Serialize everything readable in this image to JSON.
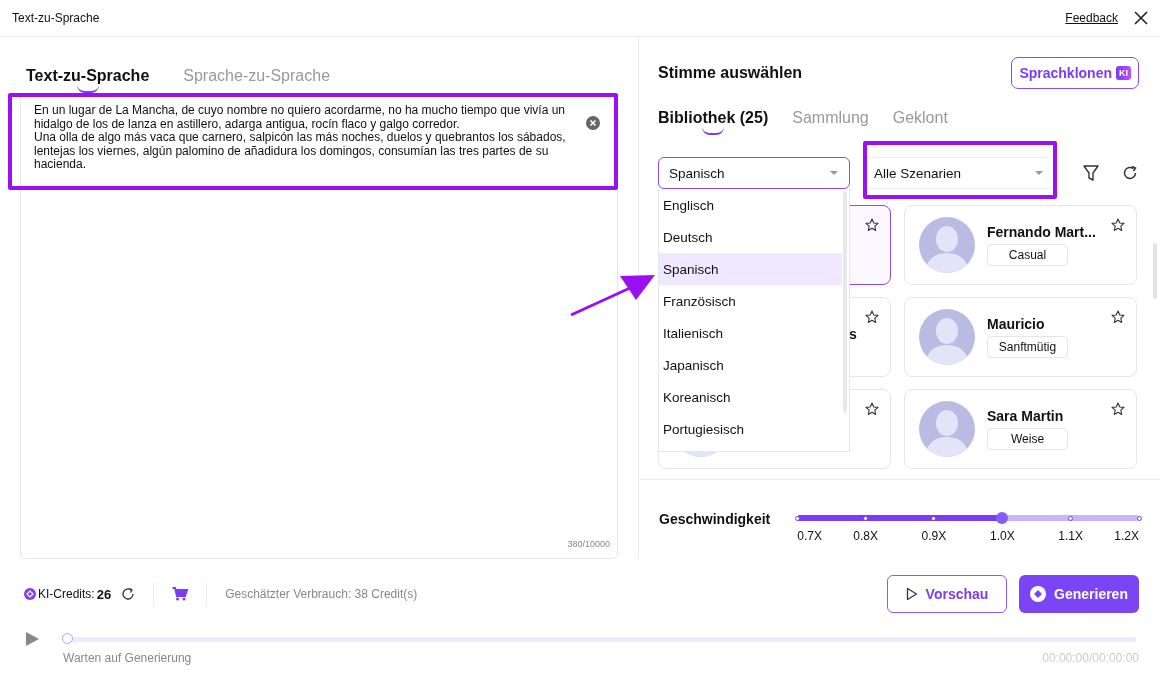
{
  "window": {
    "title": "Text-zu-Sprache",
    "feedback": "Feedback"
  },
  "mode_tabs": [
    {
      "label": "Text-zu-Sprache",
      "selected": true
    },
    {
      "label": "Sprache-zu-Sprache",
      "selected": false
    }
  ],
  "editor": {
    "paragraphs": [
      "En un lugar de La Mancha, de cuyo nombre no quiero acordarme, no ha mucho tiempo que vivía un hidalgo de los de lanza en astillero, adarga antigua, rocín flaco y galgo corredor.",
      "Una olla de algo más vaca que carnero, salpicón las más noches, duelos y quebrantos los sábados, lentejas los viernes, algún palomino de añadidura los domingos, consumían las tres partes de su hacienda."
    ],
    "char_count": "380/10000"
  },
  "voice_panel": {
    "title": "Stimme auswählen",
    "clone_button": "Sprachklonen",
    "clone_badge": "KI",
    "tabs": [
      {
        "label": "Bibliothek (25)",
        "selected": true
      },
      {
        "label": "Sammlung",
        "selected": false
      },
      {
        "label": "Geklont",
        "selected": false
      }
    ],
    "language_select": "Spanisch",
    "scenario_select": "Alle Szenarien",
    "language_options": [
      {
        "label": "Englisch",
        "selected": false
      },
      {
        "label": "Deutsch",
        "selected": false
      },
      {
        "label": "Spanisch",
        "selected": true
      },
      {
        "label": "Französisch",
        "selected": false
      },
      {
        "label": "Italienisch",
        "selected": false
      },
      {
        "label": "Japanisch",
        "selected": false
      },
      {
        "label": "Koreanisch",
        "selected": false
      },
      {
        "label": "Portugiesisch",
        "selected": false
      }
    ],
    "voices": [
      {
        "selected": true
      },
      {
        "avatar": true,
        "name": "Fernando Mart...",
        "tag": "Casual",
        "selected": false
      },
      {
        "name": "s",
        "selected": false
      },
      {
        "avatar": true,
        "name": "Mauricio",
        "tag": "Sanftmütig",
        "selected": false
      },
      {
        "avatar": true,
        "selected": false
      },
      {
        "avatar": true,
        "name": "Sara Martin",
        "tag": "Weise",
        "selected": false
      }
    ]
  },
  "speed": {
    "label": "Geschwindigkeit",
    "level": 0.6,
    "ticks": [
      "0.7X",
      "0.8X",
      "0.9X",
      "1.0X",
      "1.1X",
      "1.2X"
    ]
  },
  "footer": {
    "credits_label": "KI-Credits:",
    "credits": "26",
    "estimate": "Geschätzter Verbrauch: 38 Credit(s)",
    "preview_button": "Vorschau",
    "generate_button": "Generieren"
  },
  "player": {
    "level": 0,
    "status": "Warten auf Generierung",
    "time": "00:00:00/00:00:00"
  }
}
